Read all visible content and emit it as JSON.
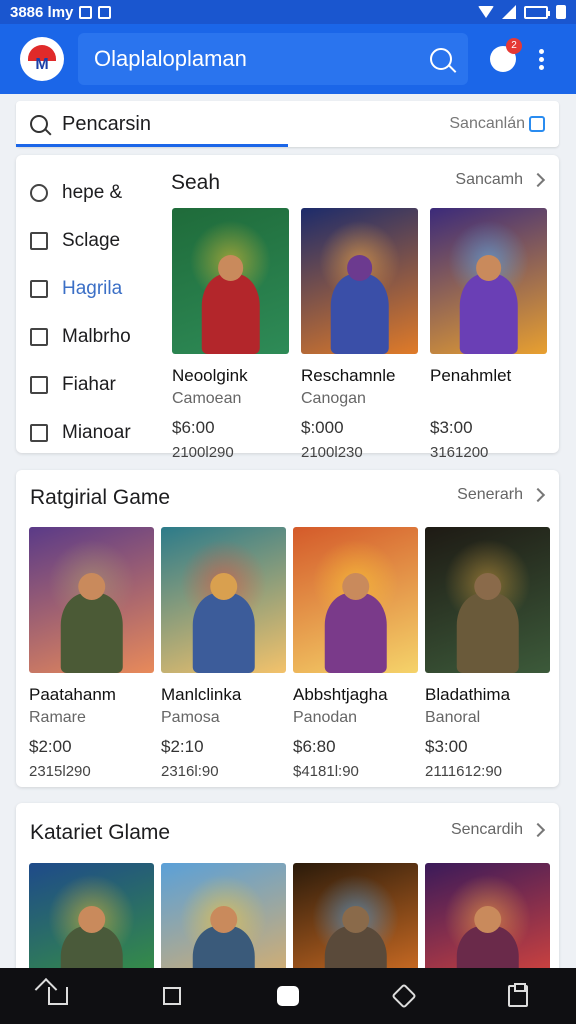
{
  "status": {
    "time": "3886 lmy"
  },
  "appbar": {
    "title": "Olaplaloplaman",
    "notif_count": "2"
  },
  "search": {
    "value": "Pencarsin",
    "hint": "Sancanlán"
  },
  "section1": {
    "title": "Seah",
    "more": "Sancamh",
    "menu": [
      "hepe &",
      "Sclage",
      "Hagrila",
      "Malbrho",
      "Fiahar",
      "Mianoar"
    ],
    "games": [
      {
        "name": "Neoolgink",
        "category": "Camoean",
        "price": "$6:00",
        "downloads": "2100l290",
        "art": {
          "bg1": "#1f6b3a",
          "bg2": "#2e8b57",
          "hero": "#b3262b",
          "head": "#c98a5c",
          "accent": "#f1c232"
        }
      },
      {
        "name": "Reschamnle",
        "category": "Canogan",
        "price": "$:000",
        "downloads": "2100l230",
        "art": {
          "bg1": "#1c2b6b",
          "bg2": "#e07b28",
          "hero": "#3a4fa8",
          "head": "#6c3a8f",
          "accent": "#ffb347"
        }
      },
      {
        "name": "Penahmlet",
        "category": "",
        "price": "$3:00",
        "downloads": "3161200",
        "art": {
          "bg1": "#3b2a7a",
          "bg2": "#e8a030",
          "hero": "#6a3fb5",
          "head": "#c98a5c",
          "accent": "#58b7ff"
        }
      }
    ]
  },
  "section2": {
    "title": "Ratgirial Game",
    "more": "Senerarh",
    "games": [
      {
        "name": "Paatahanm",
        "category": "Ramare",
        "price": "$2:00",
        "downloads": "2315l290",
        "art": {
          "bg1": "#5a3a88",
          "bg2": "#e88a5a",
          "hero": "#4b5a36",
          "head": "#c98a5c",
          "accent": "#b0a070"
        }
      },
      {
        "name": "Manlclinka",
        "category": "Pamosa",
        "price": "$2:10",
        "downloads": "2316l:90",
        "art": {
          "bg1": "#2c7b8a",
          "bg2": "#f3c26b",
          "hero": "#3c5c9a",
          "head": "#d9a04f",
          "accent": "#e84f3a"
        }
      },
      {
        "name": "Abbshtjagha",
        "category": "Panodan",
        "price": "$6:80",
        "downloads": "$4181l:90",
        "art": {
          "bg1": "#d45a2a",
          "bg2": "#f5d36a",
          "hero": "#7a3a8a",
          "head": "#c98a5c",
          "accent": "#ffcc33"
        }
      },
      {
        "name": "Bladathima",
        "category": "Banoral",
        "price": "$3:00",
        "downloads": "2111612:90",
        "art": {
          "bg1": "#1e1a14",
          "bg2": "#3c5a3a",
          "hero": "#6a5a3a",
          "head": "#8a6a4a",
          "accent": "#d4a040"
        }
      }
    ]
  },
  "section3": {
    "title": "Katariet Glame",
    "more": "Sencardih",
    "games": [
      {
        "art": {
          "bg1": "#1e4a8a",
          "bg2": "#3a9a3a",
          "hero": "#4a5a3a",
          "head": "#c98a5c",
          "accent": "#f1c232"
        }
      },
      {
        "art": {
          "bg1": "#5aa0d8",
          "bg2": "#e8b060",
          "hero": "#3a5a7a",
          "head": "#c98a5c",
          "accent": "#ffcc33"
        }
      },
      {
        "art": {
          "bg1": "#2a1a0a",
          "bg2": "#e87a28",
          "hero": "#5a4a3a",
          "head": "#8a6a4a",
          "accent": "#4ab0ff"
        }
      },
      {
        "art": {
          "bg1": "#3a1a5a",
          "bg2": "#e84a3a",
          "hero": "#6a2a4a",
          "head": "#c98a5c",
          "accent": "#ffb347"
        }
      }
    ]
  }
}
